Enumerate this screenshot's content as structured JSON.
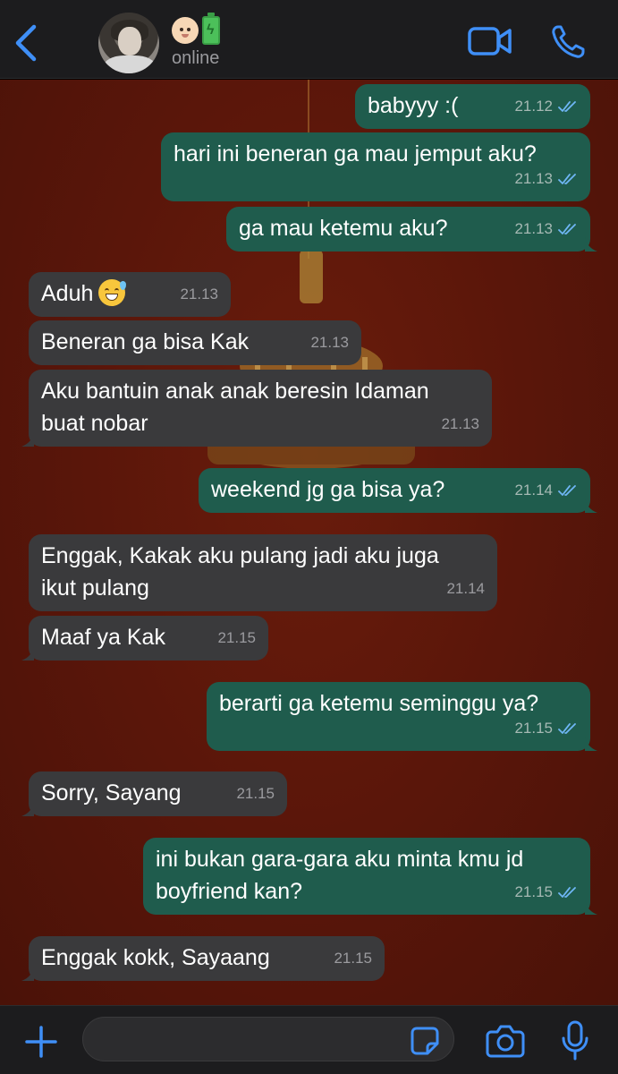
{
  "colors": {
    "accent": "#3f8ff7",
    "outgoing_bubble": "#1f5c4d",
    "incoming_bubble": "#3a3a3c",
    "wallpaper": "#5a160a",
    "read_ticks": "#6fb6f5"
  },
  "header": {
    "back_icon": "chevron-left-icon",
    "avatar_icon": "contact-avatar",
    "name_emojis": [
      "baby-face-emoji",
      "battery-emoji"
    ],
    "status": "online",
    "video_icon": "video-call-icon",
    "call_icon": "phone-call-icon"
  },
  "messages": [
    {
      "dir": "out",
      "text": "babyyy :(",
      "time": "21.12",
      "read": true
    },
    {
      "dir": "out",
      "text": "hari ini beneran ga mau jemput aku?",
      "time": "21.13",
      "read": true
    },
    {
      "dir": "out",
      "text": "ga mau ketemu aku?",
      "time": "21.13",
      "read": true
    },
    {
      "dir": "in",
      "text": "Aduh",
      "emoji": "grinning-sweat-emoji",
      "time": "21.13"
    },
    {
      "dir": "in",
      "text": "Beneran ga bisa Kak",
      "time": "21.13"
    },
    {
      "dir": "in",
      "text": "Aku bantuin anak anak beresin Idaman buat nobar",
      "time": "21.13"
    },
    {
      "dir": "out",
      "text": "weekend jg ga bisa ya?",
      "time": "21.14",
      "read": true
    },
    {
      "dir": "in",
      "text": "Enggak, Kakak aku pulang jadi aku juga ikut pulang",
      "time": "21.14"
    },
    {
      "dir": "in",
      "text": "Maaf ya Kak",
      "time": "21.15"
    },
    {
      "dir": "out",
      "text": "berarti ga ketemu seminggu ya?",
      "time": "21.15",
      "read": true
    },
    {
      "dir": "in",
      "text": "Sorry, Sayang",
      "time": "21.15"
    },
    {
      "dir": "out",
      "text": "ini bukan gara-gara aku minta kmu jd boyfriend kan?",
      "time": "21.15",
      "read": true
    },
    {
      "dir": "in",
      "text": "Enggak kokk, Sayaang",
      "time": "21.15"
    }
  ],
  "composer": {
    "plus_icon": "plus-icon",
    "input_value": "",
    "sticker_icon": "sticker-icon",
    "camera_icon": "camera-icon",
    "mic_icon": "microphone-icon"
  }
}
